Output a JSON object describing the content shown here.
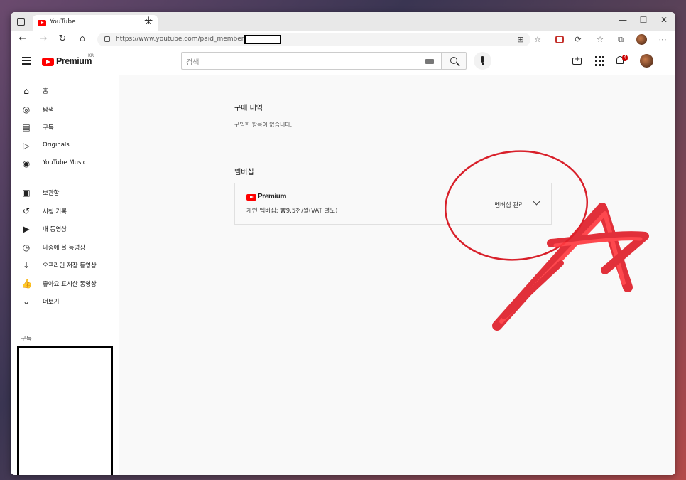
{
  "browser": {
    "tab_title": "YouTube",
    "tab_close": "✕",
    "new_tab": "+",
    "url": "https://www.youtube.com/paid_memberships",
    "window_controls": [
      "—",
      "☐",
      "✕"
    ]
  },
  "header": {
    "logo_text": "Premium",
    "country_code": "KR",
    "search_placeholder": "검색",
    "notification_count": "4"
  },
  "sidebar": {
    "items_top": [
      {
        "icon": "home-icon",
        "label": "홈"
      },
      {
        "icon": "explore-icon",
        "label": "탐색"
      },
      {
        "icon": "subscriptions-icon",
        "label": "구독"
      },
      {
        "icon": "originals-icon",
        "label": "Originals"
      },
      {
        "icon": "youtube-music-icon",
        "label": "YouTube Music"
      }
    ],
    "items_library": [
      {
        "icon": "library-icon",
        "label": "보관함"
      },
      {
        "icon": "history-icon",
        "label": "시청 기록"
      },
      {
        "icon": "my-videos-icon",
        "label": "내 동영상"
      },
      {
        "icon": "watch-later-icon",
        "label": "나중에 볼 동영상"
      },
      {
        "icon": "download-icon",
        "label": "오프라인 저장 동영상"
      },
      {
        "icon": "liked-icon",
        "label": "좋아요 표시한 동영상"
      },
      {
        "icon": "chevron-down-icon",
        "label": "더보기"
      }
    ],
    "subscriptions_heading": "구독"
  },
  "main": {
    "purchase_heading": "구매 내역",
    "purchase_empty": "구입한 항목이 없습니다.",
    "membership_heading": "멤버십",
    "membership_card": {
      "logo_text": "Premium",
      "description": "개인 멤버십: ₩9.5천/월(VAT 별도)",
      "manage_label": "멤버십 관리"
    }
  },
  "colors": {
    "brand_red": "#ff0000",
    "annotation_red": "#e0202a",
    "badge_red": "#cc0000"
  }
}
